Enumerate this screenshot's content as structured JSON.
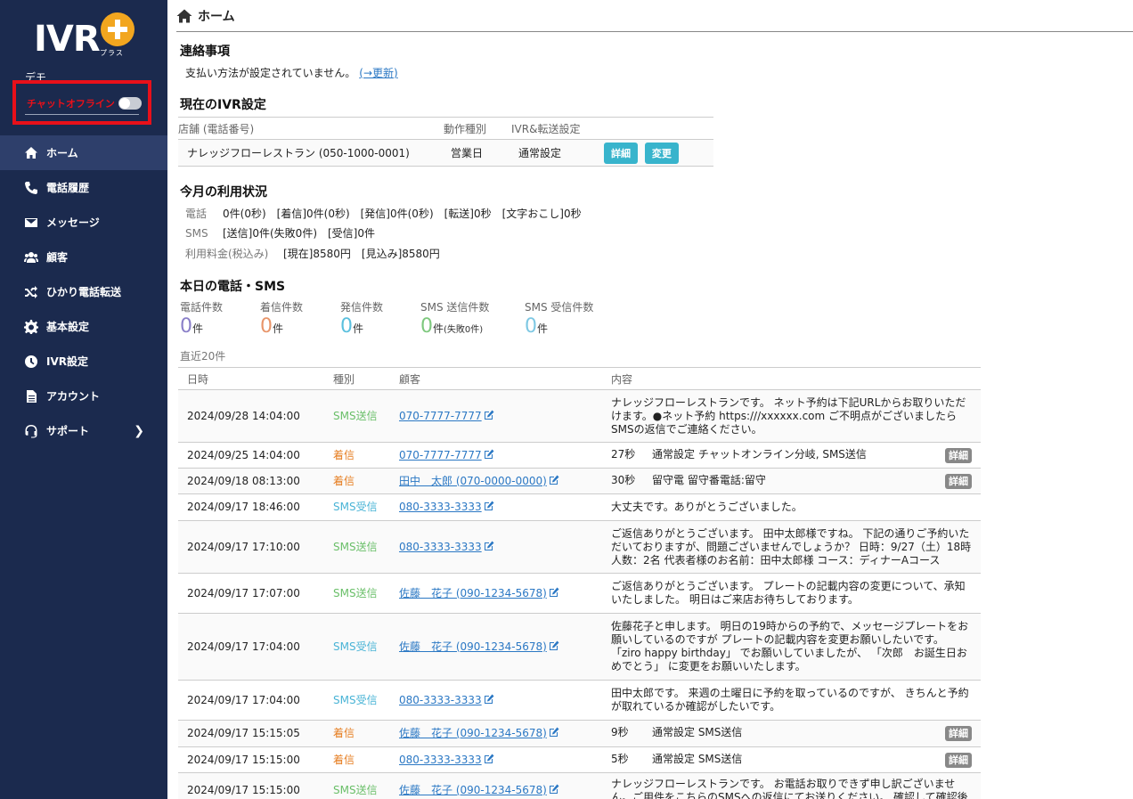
{
  "sidebar": {
    "logo_text": "IVR",
    "logo_sub": "プラス",
    "demo_label": "デモ",
    "chat_label": "チャットオフライン",
    "nav": [
      {
        "label": "ホーム",
        "icon": "home-icon",
        "active": true
      },
      {
        "label": "電話履歴",
        "icon": "phone-icon"
      },
      {
        "label": "メッセージ",
        "icon": "envelope-icon"
      },
      {
        "label": "顧客",
        "icon": "users-icon"
      },
      {
        "label": "ひかり電話転送",
        "icon": "shuffle-icon"
      },
      {
        "label": "基本設定",
        "icon": "gear-icon"
      },
      {
        "label": "IVR設定",
        "icon": "clock-icon"
      },
      {
        "label": "アカウント",
        "icon": "document-icon"
      },
      {
        "label": "サポート",
        "icon": "headset-icon"
      }
    ]
  },
  "header": {
    "title": "ホーム"
  },
  "notice": {
    "title": "連絡事項",
    "text": "支払い方法が設定されていません。",
    "link": "(→更新)"
  },
  "ivr": {
    "title": "現在のIVR設定",
    "headers": [
      "店舗 (電話番号)",
      "動作種別",
      "IVR&転送設定"
    ],
    "row": {
      "store": "ナレッジフローレストラン (050-1000-0001)",
      "mode": "営業日",
      "setting": "通常設定",
      "detail_btn": "詳細",
      "change_btn": "変更"
    }
  },
  "usage": {
    "title": "今月の利用状況",
    "phone_label": "電話",
    "phone_text": "0件(0秒)　[着信]0件(0秒)　[発信]0件(0秒)　[転送]0秒　[文字おこし]0秒",
    "sms_label": "SMS",
    "sms_text": "[送信]0件(失敗0件)　[受信]0件",
    "fee_label": "利用料金(税込み)",
    "fee_text": "[現在]8580円　[見込み]8580円"
  },
  "today": {
    "title": "本日の電話・SMS",
    "stats": [
      {
        "label": "電話件数",
        "value": "0",
        "unit": "件",
        "sub": "",
        "color": "#8a7fc8"
      },
      {
        "label": "着信件数",
        "value": "0",
        "unit": "件",
        "sub": "",
        "color": "#e8956a"
      },
      {
        "label": "発信件数",
        "value": "0",
        "unit": "件",
        "sub": "",
        "color": "#5bc0de"
      },
      {
        "label": "SMS 送信件数",
        "value": "0",
        "unit": "件",
        "sub": "(失敗0件)",
        "color": "#7ec87e"
      },
      {
        "label": "SMS 受信件数",
        "value": "0",
        "unit": "件",
        "sub": "",
        "color": "#7ec8e3"
      }
    ],
    "recent_label": "直近20件"
  },
  "log": {
    "headers": [
      "日時",
      "種別",
      "顧客",
      "内容"
    ],
    "detail_label": "詳細",
    "rows": [
      {
        "date": "2024/09/28 14:04:00",
        "type": "SMS送信",
        "kind": "sms",
        "customer": "070-7777-7777",
        "duration": "",
        "content": "ナレッジフローレストランです。 ネット予約は下記URLからお取りいただけます。●ネット予約 https:///xxxxxx.com ご不明点がございましたらSMSの返信でご連絡ください。",
        "detail": false
      },
      {
        "date": "2024/09/25 14:04:00",
        "type": "着信",
        "kind": "in",
        "customer": "070-7777-7777",
        "duration": "27秒",
        "content": "通常設定 チャットオンライン分岐, SMS送信",
        "detail": true
      },
      {
        "date": "2024/09/18 08:13:00",
        "type": "着信",
        "kind": "in",
        "customer": "田中　太郎 (070-0000-0000)",
        "duration": "30秒",
        "content": "留守電 留守番電話:留守",
        "detail": true
      },
      {
        "date": "2024/09/17 18:46:00",
        "type": "SMS受信",
        "kind": "smsr",
        "customer": "080-3333-3333",
        "duration": "",
        "content": "大丈夫です。ありがとうございました。",
        "detail": false
      },
      {
        "date": "2024/09/17 17:10:00",
        "type": "SMS送信",
        "kind": "sms",
        "customer": "080-3333-3333",
        "duration": "",
        "content": "ご返信ありがとうございます。 田中太郎様ですね。 下記の通りご予約いただいておりますが、問題ございませんでしょうか？ 日時：9/27（土）18時 人数：2名 代表者様のお名前：田中太郎様 コース：ディナーAコース",
        "detail": false
      },
      {
        "date": "2024/09/17 17:07:00",
        "type": "SMS送信",
        "kind": "sms",
        "customer": "佐藤　花子 (090-1234-5678)",
        "duration": "",
        "content": "ご返信ありがとうございます。 プレートの記載内容の変更について、承知いたしました。 明日はご来店お待ちしております。",
        "detail": false
      },
      {
        "date": "2024/09/17 17:04:00",
        "type": "SMS受信",
        "kind": "smsr",
        "customer": "佐藤　花子 (090-1234-5678)",
        "duration": "",
        "content": "佐藤花子と申します。 明日の19時からの予約で、メッセージプレートをお願いしているのですが プレートの記載内容を変更お願いしたいです。 「ziro happy birthday」 でお願いしていましたが、 「次郎　お誕生日おめでとう」 に変更をお願いいたします。",
        "detail": false
      },
      {
        "date": "2024/09/17 17:04:00",
        "type": "SMS受信",
        "kind": "smsr",
        "customer": "080-3333-3333",
        "duration": "",
        "content": "田中太郎です。 来週の土曜日に予約を取っているのですが、 きちんと予約が取れているか確認がしたいです。",
        "detail": false
      },
      {
        "date": "2024/09/17 15:15:05",
        "type": "着信",
        "kind": "in",
        "customer": "佐藤　花子 (090-1234-5678)",
        "duration": "9秒",
        "content": "通常設定 SMS送信",
        "detail": true
      },
      {
        "date": "2024/09/17 15:15:00",
        "type": "着信",
        "kind": "in",
        "customer": "080-3333-3333",
        "duration": "5秒",
        "content": "通常設定 SMS送信",
        "detail": true
      },
      {
        "date": "2024/09/17 15:15:00",
        "type": "SMS送信",
        "kind": "sms",
        "customer": "佐藤　花子 (090-1234-5678)",
        "duration": "",
        "content": "ナレッジフローレストランです。 お電話お取りできず申し訳ございません。ご用件をこちらのSMSへの返信にてお送りください。 確認して確認後",
        "detail": false
      }
    ]
  }
}
